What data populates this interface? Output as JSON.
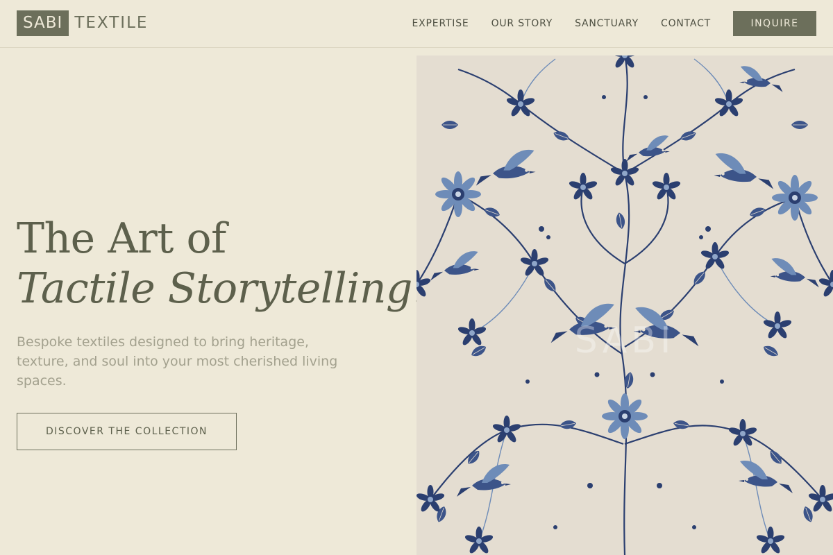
{
  "brand": {
    "logo_box": "SABI",
    "logo_rest": "TEXTILE"
  },
  "nav": {
    "items": [
      {
        "label": "EXPERTISE"
      },
      {
        "label": "OUR STORY"
      },
      {
        "label": "SANCTUARY"
      },
      {
        "label": "CONTACT"
      }
    ],
    "cta": "INQUIRE"
  },
  "hero": {
    "title_line1": "The Art of",
    "title_line2": "Tactile Storytelling.",
    "description": "Bespoke textiles designed to bring heritage, texture, and soul into your most cherished living spaces.",
    "button": "DISCOVER THE COLLECTION",
    "image_watermark": "SABI"
  },
  "colors": {
    "background": "#EEE9D8",
    "brand_olive": "#6C6F5B",
    "text_dark": "#4E5042",
    "text_muted": "#A3A18E",
    "pattern_blue": "#2B3F70",
    "pattern_light_blue": "#6E8CB8",
    "fabric": "#E4DDD1"
  },
  "icons": {
    "pattern": "floral-bird-textile-illustration"
  }
}
